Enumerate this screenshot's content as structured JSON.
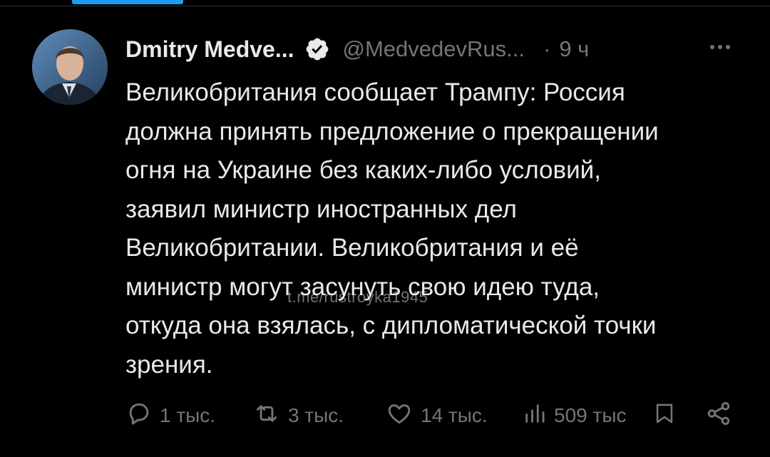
{
  "tweet": {
    "author": {
      "display_name": "Dmitry Medve...",
      "handle": "@MedvedevRus...",
      "verified": true
    },
    "separator": "·",
    "time": "9 ч",
    "more_label": "•••",
    "text": "Великобритания сообщает Трампу: Россия\nдолжна принять предложение о прекращении\nогня на Украине без каких-либо условий,\nзаявил министр иностранных дел\nВеликобритании. Великобритания и её\nминистр могут засунуть свою идею туда,\nоткуда она взялась, с дипломатической точки\nзрения.",
    "watermark": "t.me/rustroyka1945",
    "actions": {
      "replies": "1 тыс.",
      "retweets": "3 тыс.",
      "likes": "14 тыс.",
      "views": "509 тыс"
    }
  },
  "icons": {
    "reply": "speech-bubble-icon",
    "retweet": "retweet-arrows-icon",
    "like": "heart-icon",
    "views": "bar-chart-icon",
    "bookmark": "bookmark-icon",
    "share": "share-icon",
    "verified": "verified-badge-icon",
    "more": "more-dots-icon"
  },
  "colors": {
    "background": "#000000",
    "text_primary": "#e7e9ea",
    "text_secondary": "#71767b",
    "accent": "#1d9bf0",
    "divider": "#2f3336"
  }
}
